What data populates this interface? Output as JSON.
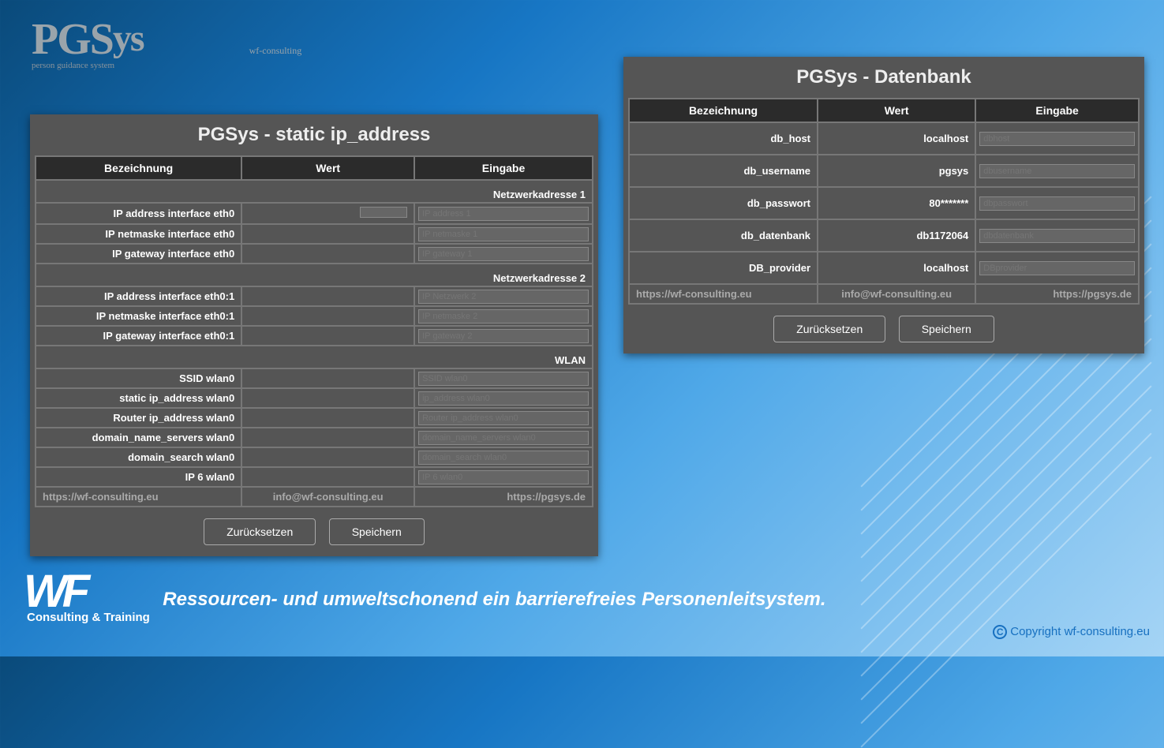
{
  "logo": {
    "main": "PGSys",
    "tag": "wf-consulting",
    "sub": "person guidance system"
  },
  "panel_left": {
    "title": "PGSys - static ip_address",
    "headers": [
      "Bezeichnung",
      "Wert",
      "Eingabe"
    ],
    "sections": [
      {
        "section": "Netzwerkadresse 1",
        "rows": [
          {
            "label": "IP address interface eth0",
            "wert_box": true,
            "placeholder": "IP address 1"
          },
          {
            "label": "IP netmaske interface eth0",
            "wert": "",
            "placeholder": "IP netmaske 1"
          },
          {
            "label": "IP gateway interface eth0",
            "wert": "",
            "placeholder": "IP gateway 1"
          }
        ]
      },
      {
        "section": "Netzwerkadresse 2",
        "rows": [
          {
            "label": "IP address interface eth0:1",
            "wert": "",
            "placeholder": "IP Netzwerk 2"
          },
          {
            "label": "IP netmaske interface eth0:1",
            "wert": "",
            "placeholder": "IP netmaske 2"
          },
          {
            "label": "IP gateway interface eth0:1",
            "wert": "",
            "placeholder": "IP gateway 2"
          }
        ]
      },
      {
        "section": "WLAN",
        "rows": [
          {
            "label": "SSID wlan0",
            "wert": "",
            "placeholder": "SSID wlan0"
          },
          {
            "label": "static ip_address wlan0",
            "wert": "",
            "placeholder": "ip_address wlan0"
          },
          {
            "label": "Router ip_address wlan0",
            "wert": "",
            "placeholder": "Router ip_address wlan0"
          },
          {
            "label": "domain_name_servers wlan0",
            "wert": "",
            "placeholder": "domain_name_servers wlan0"
          },
          {
            "label": "domain_search wlan0",
            "wert": "",
            "placeholder": "domain_search wlan0"
          },
          {
            "label": "IP 6 wlan0",
            "wert": "",
            "placeholder": "IP 6 wlan0"
          }
        ]
      }
    ],
    "footer": [
      "https://wf-consulting.eu",
      "info@wf-consulting.eu",
      "https://pgsys.de"
    ],
    "buttons": {
      "reset": "Zurücksetzen",
      "save": "Speichern"
    }
  },
  "panel_right": {
    "title": "PGSys - Datenbank",
    "headers": [
      "Bezeichnung",
      "Wert",
      "Eingabe"
    ],
    "rows": [
      {
        "label": "db_host",
        "wert": "localhost",
        "placeholder": "dbhost"
      },
      {
        "label": "db_username",
        "wert": "pgsys",
        "placeholder": "dbusername"
      },
      {
        "label": "db_passwort",
        "wert": "80*******",
        "placeholder": "dbpasswort"
      },
      {
        "label": "db_datenbank",
        "wert": "db1172064",
        "placeholder": "dbdatenbank"
      },
      {
        "label": "DB_provider",
        "wert": "localhost",
        "placeholder": "DBprovider"
      }
    ],
    "footer": [
      "https://wf-consulting.eu",
      "info@wf-consulting.eu",
      "https://pgsys.de"
    ],
    "buttons": {
      "reset": "Zurücksetzen",
      "save": "Speichern"
    }
  },
  "bottom": {
    "wf": "WF",
    "ct": "Consulting & Training",
    "tagline": "Ressourcen- und umweltschonend ein barrierefreies Personenleitsystem.",
    "copyright": "Copyright wf-consulting.eu"
  }
}
